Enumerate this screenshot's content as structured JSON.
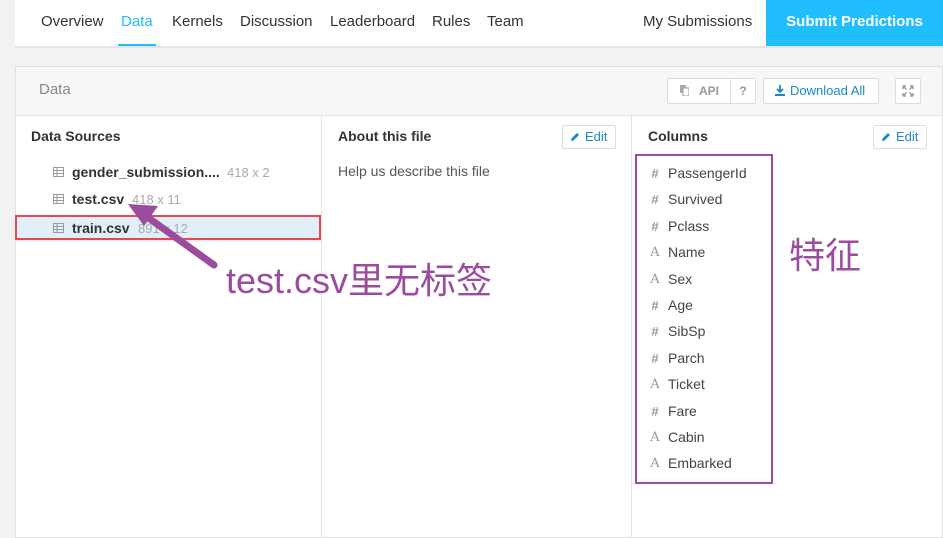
{
  "nav": {
    "tabs": [
      "Overview",
      "Data",
      "Kernels",
      "Discussion",
      "Leaderboard",
      "Rules",
      "Team"
    ],
    "active_tab": "Data",
    "my_submissions": "My Submissions",
    "submit_label": "Submit Predictions"
  },
  "panel": {
    "title": "Data",
    "api_label": "API",
    "help_label": "?",
    "download_label": "Download All"
  },
  "data_sources": {
    "title": "Data Sources",
    "files": [
      {
        "name": "gender_submission....",
        "dims": "418 x 2"
      },
      {
        "name": "test.csv",
        "dims": "418 x 11"
      },
      {
        "name": "train.csv",
        "dims": "891 x 12"
      }
    ],
    "selected": "train.csv"
  },
  "about": {
    "title": "About this file",
    "edit_label": "Edit",
    "text": "Help us describe this file"
  },
  "columns": {
    "title": "Columns",
    "edit_label": "Edit",
    "items": [
      {
        "name": "PassengerId",
        "type": "numeric"
      },
      {
        "name": "Survived",
        "type": "numeric"
      },
      {
        "name": "Pclass",
        "type": "numeric"
      },
      {
        "name": "Name",
        "type": "string"
      },
      {
        "name": "Sex",
        "type": "string"
      },
      {
        "name": "Age",
        "type": "numeric"
      },
      {
        "name": "SibSp",
        "type": "numeric"
      },
      {
        "name": "Parch",
        "type": "numeric"
      },
      {
        "name": "Ticket",
        "type": "string"
      },
      {
        "name": "Fare",
        "type": "numeric"
      },
      {
        "name": "Cabin",
        "type": "string"
      },
      {
        "name": "Embarked",
        "type": "string"
      }
    ]
  },
  "annotations": {
    "arrow_note": "test.csv里无标签",
    "columns_note": "特征",
    "accent_color": "#9b4c9e",
    "highlight_color": "#e8474c"
  },
  "colors": {
    "brand": "#20beff",
    "link": "#1a8bbf"
  }
}
